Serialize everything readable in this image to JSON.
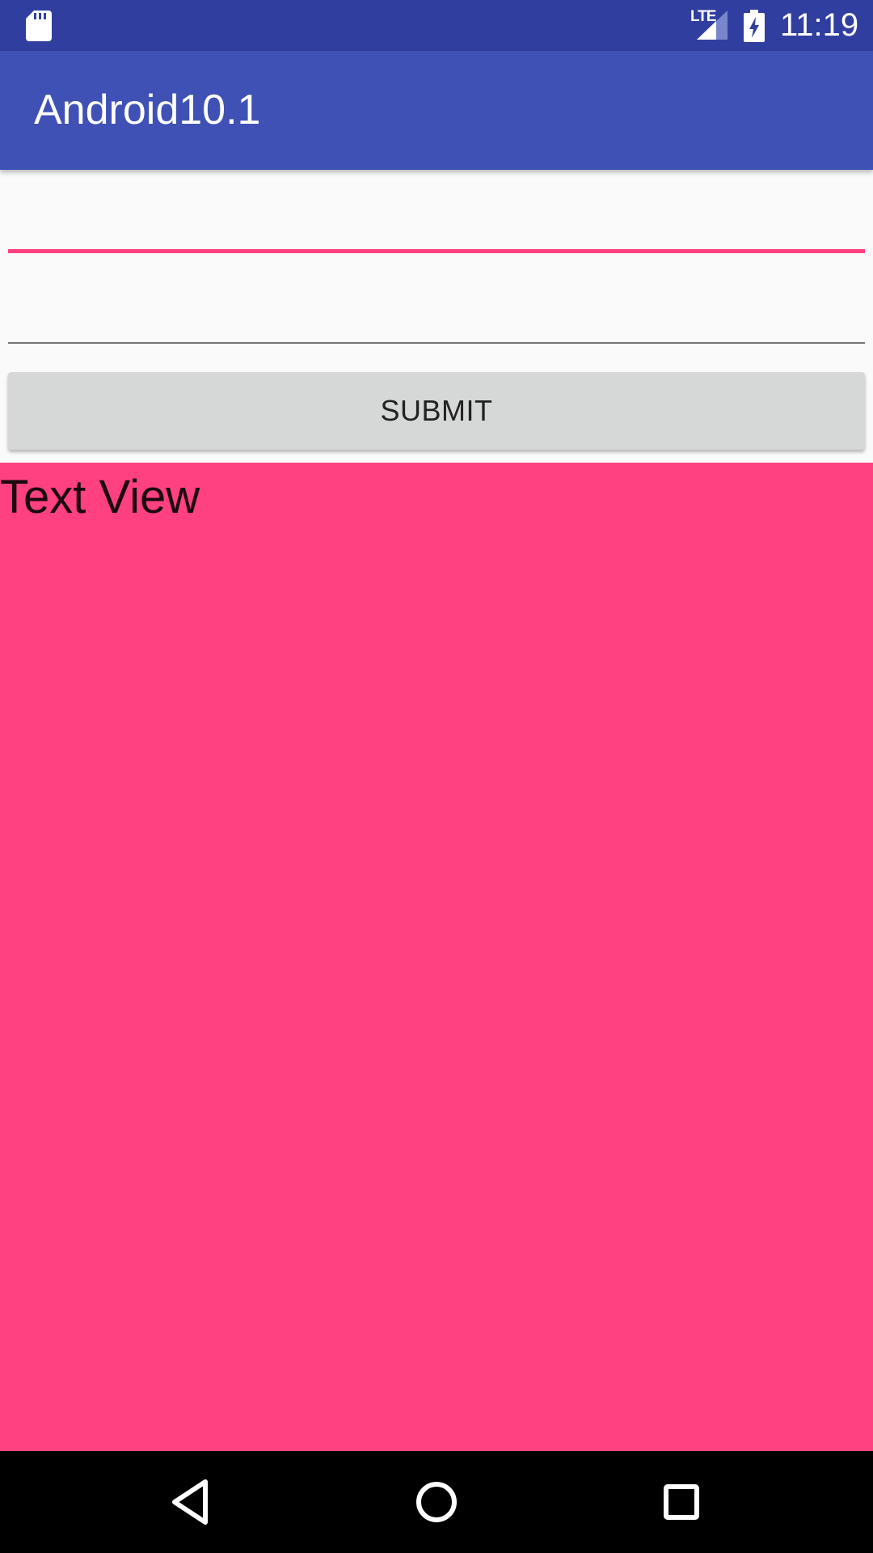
{
  "status_bar": {
    "network_label": "LTE",
    "clock": "11:19",
    "icons": [
      "sd-card-icon",
      "signal-icon",
      "battery-charging-icon"
    ]
  },
  "app_bar": {
    "title": "Android10.1"
  },
  "form": {
    "field_1_value": "",
    "field_2_value": "",
    "submit_label": "SUBMIT"
  },
  "text_view": {
    "text": "Text View"
  },
  "nav_bar": {
    "icons": [
      "back-icon",
      "home-icon",
      "recents-icon"
    ]
  },
  "colors": {
    "status_bar": "#303f9f",
    "app_bar": "#3f51b5",
    "accent": "#ff4081",
    "text_view_background": "#ff4081",
    "button": "#d6d7d7"
  }
}
